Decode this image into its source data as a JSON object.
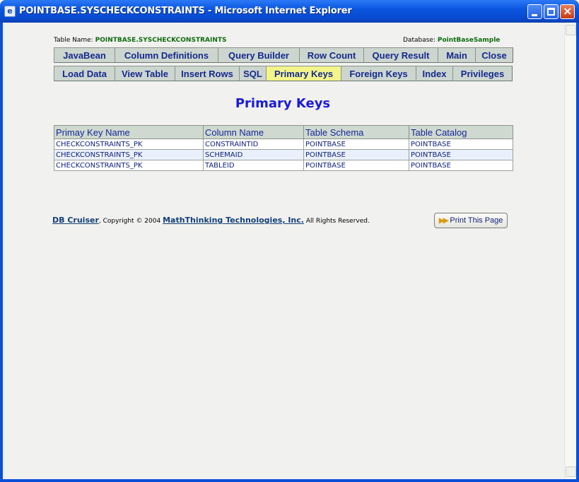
{
  "window": {
    "title": "POINTBASE.SYSCHECKCONSTRAINTS - Microsoft Internet Explorer",
    "icon": "ie-page-icon"
  },
  "header": {
    "table_name_label": "Table Name:",
    "table_name_value": "POINTBASE.SYSCHECKCONSTRAINTS",
    "database_label": "Database:",
    "database_value": "PointBaseSample"
  },
  "tabs_row1": [
    "JavaBean",
    "Column Definitions",
    "Query Builder",
    "Row Count",
    "Query Result",
    "Main",
    "Close"
  ],
  "tabs_row2": [
    "Load Data",
    "View Table",
    "Insert Rows",
    "SQL",
    "Primary Keys",
    "Foreign Keys",
    "Index",
    "Privileges"
  ],
  "active_tab": "Primary Keys",
  "page_title": "Primary Keys",
  "table": {
    "columns": [
      "Primay Key Name",
      "Column Name",
      "Table Schema",
      "Table Catalog"
    ],
    "rows": [
      [
        "CHECKCONSTRAINTS_PK",
        "CONSTRAINTID",
        "POINTBASE",
        "POINTBASE"
      ],
      [
        "CHECKCONSTRAINTS_PK",
        "SCHEMAID",
        "POINTBASE",
        "POINTBASE"
      ],
      [
        "CHECKCONSTRAINTS_PK",
        "TABLEID",
        "POINTBASE",
        "POINTBASE"
      ]
    ]
  },
  "footer": {
    "product_link": "DB Cruiser",
    "copyright": ", Copyright © 2004",
    "company_link": "MathThinking Technologies, Inc.",
    "rights": "All Rights Reserved.",
    "print_button": "Print This Page"
  },
  "colors": {
    "tab_bg": "#cdd5cf",
    "tab_active_bg": "#f3f58a",
    "tab_text": "#13298c",
    "title_blue": "#1a1ad8",
    "label_green": "#0d6b0d"
  }
}
